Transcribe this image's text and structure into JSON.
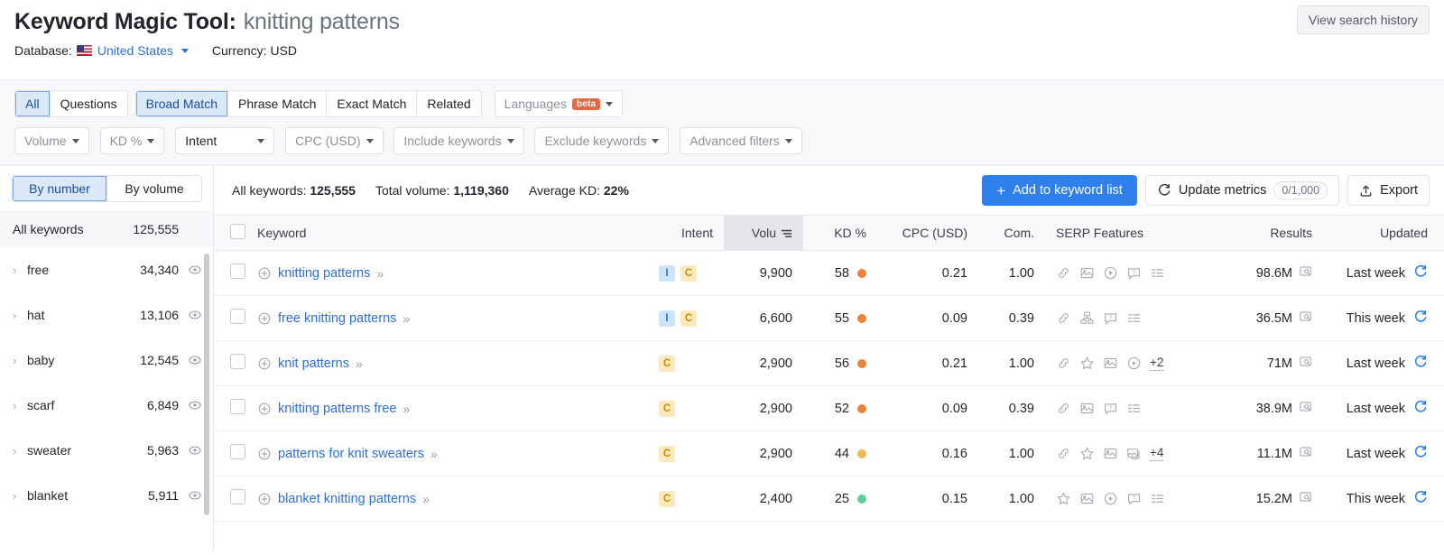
{
  "header": {
    "title_main": "Keyword Magic Tool:",
    "title_keyword": "knitting patterns",
    "database_label": "Database:",
    "database_value": "United States",
    "currency_label": "Currency: USD",
    "history_button": "View search history"
  },
  "filters": {
    "match_group_1": [
      {
        "label": "All",
        "active": true
      },
      {
        "label": "Questions",
        "active": false
      }
    ],
    "match_group_2": [
      {
        "label": "Broad Match",
        "active": true
      },
      {
        "label": "Phrase Match",
        "active": false
      },
      {
        "label": "Exact Match",
        "active": false
      },
      {
        "label": "Related",
        "active": false
      }
    ],
    "languages": {
      "label": "Languages",
      "badge": "beta"
    },
    "row2": [
      {
        "label": "Volume",
        "muted": true
      },
      {
        "label": "KD %",
        "muted": true
      },
      {
        "label": "Intent",
        "muted": false
      },
      {
        "label": "CPC (USD)",
        "muted": true
      },
      {
        "label": "Include keywords",
        "muted": true
      },
      {
        "label": "Exclude keywords",
        "muted": true
      },
      {
        "label": "Advanced filters",
        "muted": true
      }
    ]
  },
  "sidebar": {
    "toggle": [
      {
        "label": "By number",
        "active": true
      },
      {
        "label": "By volume",
        "active": false
      }
    ],
    "all_row": {
      "label": "All keywords",
      "count": "125,555"
    },
    "groups": [
      {
        "label": "free",
        "count": "34,340"
      },
      {
        "label": "hat",
        "count": "13,106"
      },
      {
        "label": "baby",
        "count": "12,545"
      },
      {
        "label": "scarf",
        "count": "6,849"
      },
      {
        "label": "sweater",
        "count": "5,963"
      },
      {
        "label": "blanket",
        "count": "5,911"
      }
    ]
  },
  "toolbar": {
    "all_keywords_label": "All keywords:",
    "all_keywords_value": "125,555",
    "total_volume_label": "Total volume:",
    "total_volume_value": "1,119,360",
    "average_kd_label": "Average KD:",
    "average_kd_value": "22%",
    "add_to_list": "Add to keyword list",
    "update_metrics": "Update metrics",
    "update_metrics_count": "0/1,000",
    "export": "Export"
  },
  "table": {
    "columns": [
      {
        "key": "keyword",
        "label": "Keyword"
      },
      {
        "key": "intent",
        "label": "Intent"
      },
      {
        "key": "volume",
        "label": "Volu",
        "sorted": true
      },
      {
        "key": "kd",
        "label": "KD %"
      },
      {
        "key": "cpc",
        "label": "CPC (USD)"
      },
      {
        "key": "com",
        "label": "Com."
      },
      {
        "key": "serp",
        "label": "SERP Features"
      },
      {
        "key": "results",
        "label": "Results"
      },
      {
        "key": "updated",
        "label": "Updated"
      }
    ],
    "rows": [
      {
        "keyword": "knitting patterns",
        "intent": [
          "I",
          "C"
        ],
        "volume": "9,900",
        "kd": "58",
        "kd_color": "#e8833a",
        "cpc": "0.21",
        "com": "1.00",
        "serp": [
          "link",
          "image",
          "video",
          "faq",
          "list"
        ],
        "serp_more": "",
        "results": "98.6M",
        "updated": "Last week"
      },
      {
        "keyword": "free knitting patterns",
        "intent": [
          "I",
          "C"
        ],
        "volume": "6,600",
        "kd": "55",
        "kd_color": "#e8833a",
        "cpc": "0.09",
        "com": "0.39",
        "serp": [
          "link",
          "sitelinks",
          "faq",
          "list"
        ],
        "serp_more": "",
        "results": "36.5M",
        "updated": "This week"
      },
      {
        "keyword": "knit patterns",
        "intent": [
          "C"
        ],
        "volume": "2,900",
        "kd": "56",
        "kd_color": "#e8833a",
        "cpc": "0.21",
        "com": "1.00",
        "serp": [
          "link",
          "star",
          "image",
          "video"
        ],
        "serp_more": "+2",
        "results": "71M",
        "updated": "Last week"
      },
      {
        "keyword": "knitting patterns free",
        "intent": [
          "C"
        ],
        "volume": "2,900",
        "kd": "52",
        "kd_color": "#e8833a",
        "cpc": "0.09",
        "com": "0.39",
        "serp": [
          "link",
          "image",
          "faq",
          "list"
        ],
        "serp_more": "",
        "results": "38.9M",
        "updated": "Last week"
      },
      {
        "keyword": "patterns for knit sweaters",
        "intent": [
          "C"
        ],
        "volume": "2,900",
        "kd": "44",
        "kd_color": "#f0b94a",
        "cpc": "0.16",
        "com": "1.00",
        "serp": [
          "link",
          "star",
          "image",
          "imagepack"
        ],
        "serp_more": "+4",
        "results": "11.1M",
        "updated": "Last week"
      },
      {
        "keyword": "blanket knitting patterns",
        "intent": [
          "C"
        ],
        "volume": "2,400",
        "kd": "25",
        "kd_color": "#5fcf9a",
        "cpc": "0.15",
        "com": "1.00",
        "serp": [
          "star",
          "image",
          "video",
          "faq",
          "list"
        ],
        "serp_more": "",
        "results": "15.2M",
        "updated": "This week"
      }
    ]
  },
  "colors": {
    "accent_blue": "#2f80ed",
    "link_blue": "#2f6fd6",
    "beta_orange": "#e06c43"
  }
}
